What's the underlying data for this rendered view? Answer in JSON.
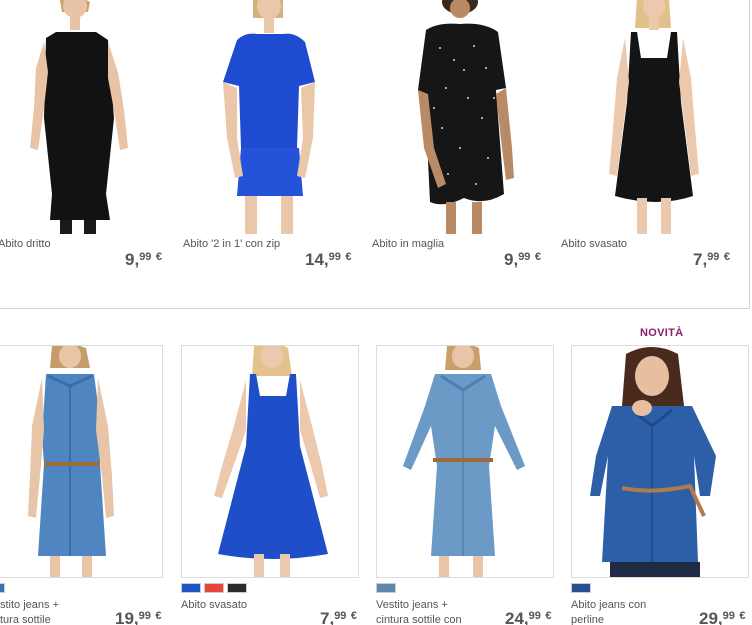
{
  "top_products": [
    {
      "name": "Abito dritto",
      "price_int": "9,",
      "price_dec": "99",
      "currency": "€"
    },
    {
      "name": "Abito '2 in 1' con zip",
      "price_int": "14,",
      "price_dec": "99",
      "currency": "€"
    },
    {
      "name": "Abito in maglia",
      "price_int": "9,",
      "price_dec": "99",
      "currency": "€"
    },
    {
      "name": "Abito svasato",
      "price_int": "7,",
      "price_dec": "99",
      "currency": "€"
    }
  ],
  "bottom_products": [
    {
      "badge": "",
      "name_line1": "stito jeans +",
      "name_line2": "tura sottile",
      "price_int": "19,",
      "price_dec": "99",
      "currency": "€",
      "swatches": [
        "#3a72b8"
      ]
    },
    {
      "badge": "",
      "name_line1": "Abito svasato",
      "name_line2": "",
      "price_int": "7,",
      "price_dec": "99",
      "currency": "€",
      "swatches": [
        "#1e56c4",
        "#e6453a",
        "#2b2b2b"
      ]
    },
    {
      "badge": "",
      "name_line1": "Vestito jeans +",
      "name_line2": "cintura sottile con",
      "price_int": "24,",
      "price_dec": "99",
      "currency": "€",
      "swatches": [
        "#5b87ad"
      ]
    },
    {
      "badge": "NOVITÀ",
      "name_line1": "Abito jeans con",
      "name_line2": "perline",
      "price_int": "29,",
      "price_dec": "99",
      "currency": "€",
      "swatches": [
        "#274f8f"
      ]
    }
  ],
  "colors": {
    "badge": "#8b1a6b",
    "price": "#555555",
    "border": "#d4d4d4"
  }
}
